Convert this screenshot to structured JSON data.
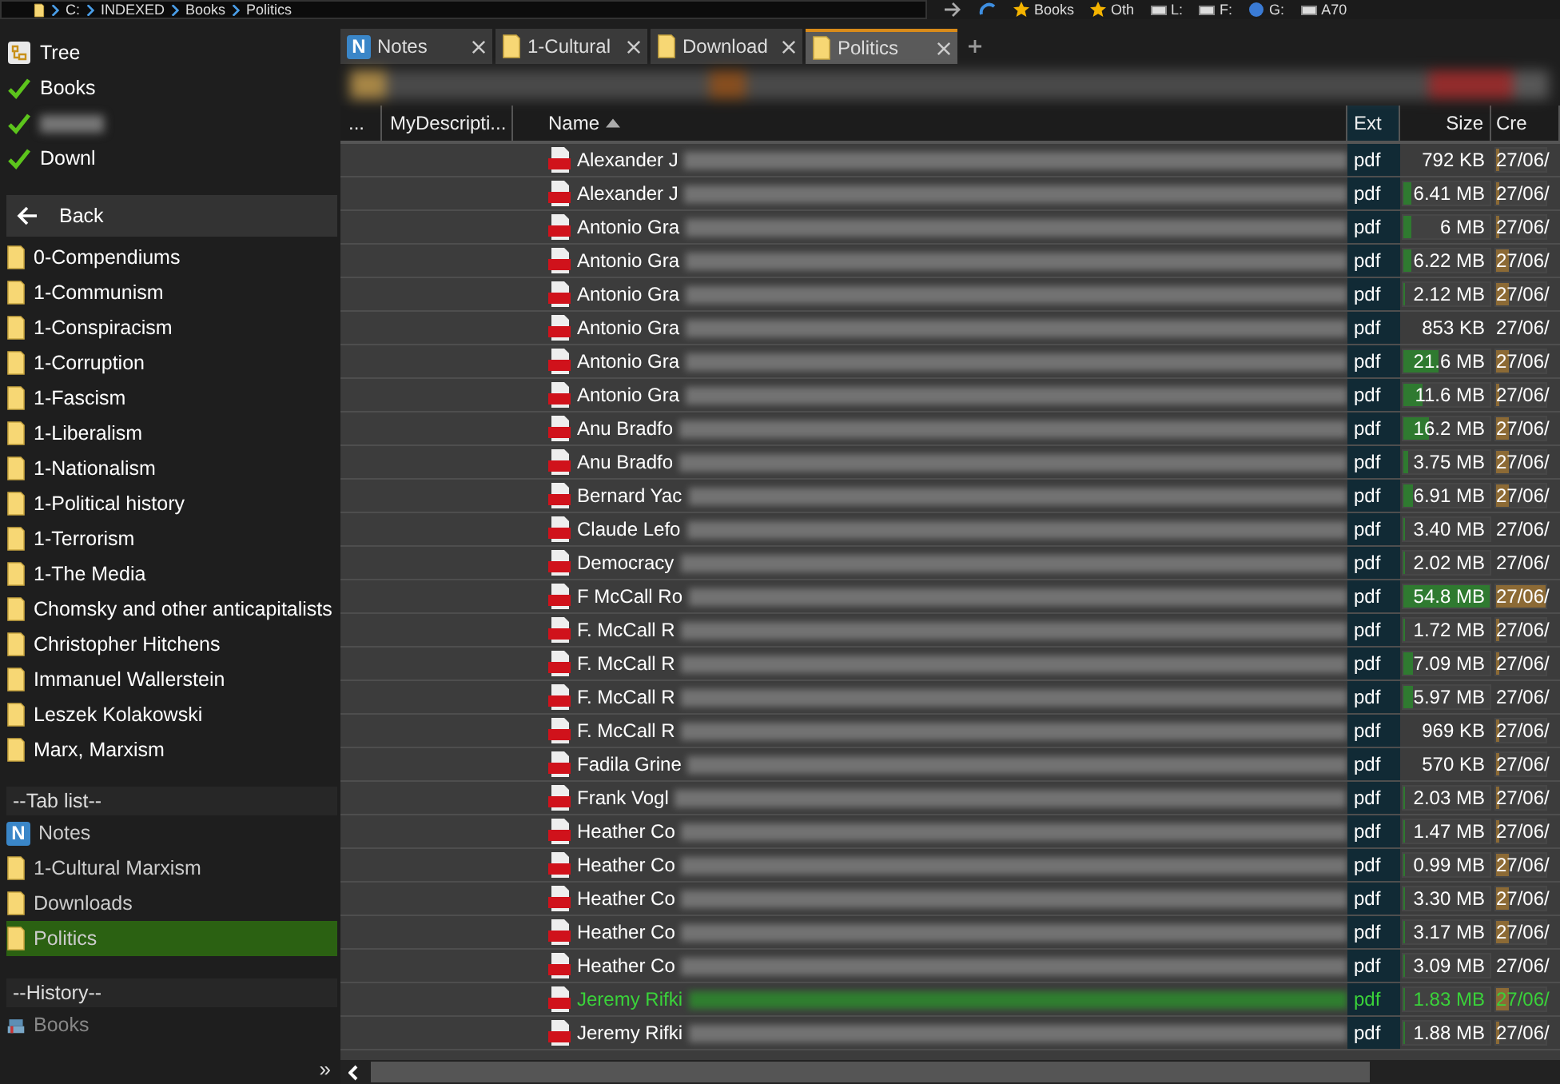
{
  "address_bar": {
    "segments": [
      "C:",
      "INDEXED",
      "Books",
      "Politics"
    ]
  },
  "top_toolbar": [
    {
      "kind": "star",
      "label": "Books"
    },
    {
      "kind": "star",
      "label": "Oth"
    },
    {
      "kind": "drive",
      "label": "L:"
    },
    {
      "kind": "drive",
      "label": "F:"
    },
    {
      "kind": "globe",
      "label": "G:"
    },
    {
      "kind": "drive",
      "label": "A70"
    }
  ],
  "sidebar": {
    "tree_label": "Tree",
    "favorites": [
      {
        "label": "Books",
        "blurred": false
      },
      {
        "blurred": true
      },
      {
        "label": "Downl",
        "blurred": false
      }
    ],
    "back_label": "Back",
    "folders": [
      "0-Compendiums",
      "1-Communism",
      "1-Conspiracism",
      "1-Corruption",
      "1-Fascism",
      "1-Liberalism",
      "1-Nationalism",
      "1-Political history",
      "1-Terrorism",
      "1-The Media",
      "Chomsky and other anticapitalists",
      "Christopher Hitchens",
      "Immanuel Wallerstein",
      "Leszek Kolakowski",
      "Marx, Marxism"
    ],
    "tab_list_heading": "--Tab list--",
    "tab_list": [
      {
        "kind": "notes",
        "icon_text": "N",
        "label": "Notes",
        "selected": false
      },
      {
        "kind": "folder",
        "label": "1-Cultural Marxism",
        "selected": false
      },
      {
        "kind": "folder",
        "label": "Downloads",
        "selected": false
      },
      {
        "kind": "folder",
        "label": "Politics",
        "selected": true
      }
    ],
    "history_heading": "--History--",
    "history": [
      {
        "label": "Books",
        "disabled": true
      }
    ],
    "expand_glyph": "»"
  },
  "tabs": [
    {
      "kind": "notes",
      "icon_text": "N",
      "label": "Notes",
      "selected": false
    },
    {
      "kind": "folder",
      "label": "1-Cultural",
      "selected": false
    },
    {
      "kind": "folder",
      "label": "Download",
      "selected": false
    },
    {
      "kind": "folder",
      "label": "Politics",
      "selected": true
    }
  ],
  "table": {
    "columns": [
      {
        "label": "..."
      },
      {
        "label": "MyDescripti..."
      },
      {
        "label": "Name",
        "sorted": true
      },
      {
        "label": "Ext"
      },
      {
        "label": "Size"
      },
      {
        "label": "Cre"
      }
    ],
    "rows": [
      {
        "name": "Alexander J",
        "ext": "pdf",
        "size": {
          "text": "792 KB"
        },
        "created": {
          "text": "27/06/",
          "level": 0.05
        },
        "highlighted": false
      },
      {
        "name": "Alexander J",
        "ext": "pdf",
        "size": {
          "text": "6.41 MB",
          "level": 0.1
        },
        "created": {
          "text": "27/06/",
          "level": 0.05
        },
        "highlighted": false
      },
      {
        "name": "Antonio Gra",
        "ext": "pdf",
        "size": {
          "text": "6 MB",
          "level": 0.1
        },
        "created": {
          "text": "27/06/",
          "level": 0.05
        },
        "highlighted": false
      },
      {
        "name": "Antonio Gra",
        "ext": "pdf",
        "size": {
          "text": "6.22 MB",
          "level": 0.1
        },
        "created": {
          "text": "27/06/",
          "level": 0.25
        },
        "highlighted": false
      },
      {
        "name": "Antonio Gra",
        "ext": "pdf",
        "size": {
          "text": "2.12 MB",
          "level": 0.02
        },
        "created": {
          "text": "27/06/",
          "level": 0.25
        },
        "highlighted": false
      },
      {
        "name": "Antonio Gra",
        "ext": "pdf",
        "size": {
          "text": "853 KB"
        },
        "created": {
          "text": "27/06/"
        },
        "highlighted": false
      },
      {
        "name": "Antonio Gra",
        "ext": "pdf",
        "size": {
          "text": "21.6 MB",
          "level": 0.4
        },
        "created": {
          "text": "27/06/",
          "level": 0.25
        },
        "highlighted": false
      },
      {
        "name": "Antonio Gra",
        "ext": "pdf",
        "size": {
          "text": "11.6 MB",
          "level": 0.22
        },
        "created": {
          "text": "27/06/",
          "level": 0.05
        },
        "highlighted": false
      },
      {
        "name": "Anu Bradfo",
        "ext": "pdf",
        "size": {
          "text": "16.2 MB",
          "level": 0.3
        },
        "created": {
          "text": "27/06/",
          "level": 0.25
        },
        "highlighted": false
      },
      {
        "name": "Anu Bradfo",
        "ext": "pdf",
        "size": {
          "text": "3.75 MB",
          "level": 0.06
        },
        "created": {
          "text": "27/06/",
          "level": 0.25
        },
        "highlighted": false
      },
      {
        "name": "Bernard Yac",
        "ext": "pdf",
        "size": {
          "text": "6.91 MB",
          "level": 0.12
        },
        "created": {
          "text": "27/06/",
          "level": 0.25
        },
        "highlighted": false
      },
      {
        "name": "Claude Lefo",
        "ext": "pdf",
        "size": {
          "text": "3.40 MB",
          "level": 0.02
        },
        "created": {
          "text": "27/06/"
        },
        "highlighted": false
      },
      {
        "name": "Democracy",
        "ext": "pdf",
        "size": {
          "text": "2.02 MB",
          "level": 0.02
        },
        "created": {
          "text": "27/06/"
        },
        "highlighted": false
      },
      {
        "name": "F McCall Ro",
        "ext": "pdf",
        "size": {
          "text": "54.8 MB",
          "level": 1
        },
        "created": {
          "text": "27/06/",
          "level": 1
        },
        "highlighted": false
      },
      {
        "name": "F. McCall R",
        "ext": "pdf",
        "size": {
          "text": "1.72 MB",
          "level": 0.02
        },
        "created": {
          "text": "27/06/",
          "level": 0.05
        },
        "highlighted": false
      },
      {
        "name": "F. McCall R",
        "ext": "pdf",
        "size": {
          "text": "7.09 MB",
          "level": 0.12
        },
        "created": {
          "text": "27/06/",
          "level": 0.05
        },
        "highlighted": false
      },
      {
        "name": "F. McCall R",
        "ext": "pdf",
        "size": {
          "text": "5.97 MB",
          "level": 0.12
        },
        "created": {
          "text": "27/06/"
        },
        "highlighted": false
      },
      {
        "name": "F. McCall R",
        "ext": "pdf",
        "size": {
          "text": "969 KB"
        },
        "created": {
          "text": "27/06/",
          "level": 0.05
        },
        "highlighted": false
      },
      {
        "name": "Fadila Grine",
        "ext": "pdf",
        "size": {
          "text": "570 KB"
        },
        "created": {
          "text": "27/06/",
          "level": 0.05
        },
        "highlighted": false
      },
      {
        "name": "Frank Vogl",
        "ext": "pdf",
        "size": {
          "text": "2.03 MB",
          "level": 0.02
        },
        "created": {
          "text": "27/06/",
          "level": 0.05
        },
        "highlighted": false
      },
      {
        "name": "Heather Co",
        "ext": "pdf",
        "size": {
          "text": "1.47 MB",
          "level": 0.02
        },
        "created": {
          "text": "27/06/",
          "level": 0.05
        },
        "highlighted": false
      },
      {
        "name": "Heather Co",
        "ext": "pdf",
        "size": {
          "text": "0.99 MB",
          "level": 0.02
        },
        "created": {
          "text": "27/06/",
          "level": 0.25
        },
        "highlighted": false
      },
      {
        "name": "Heather Co",
        "ext": "pdf",
        "size": {
          "text": "3.30 MB",
          "level": 0.02
        },
        "created": {
          "text": "27/06/",
          "level": 0.25
        },
        "highlighted": false
      },
      {
        "name": "Heather Co",
        "ext": "pdf",
        "size": {
          "text": "3.17 MB",
          "level": 0.02
        },
        "created": {
          "text": "27/06/",
          "level": 0.25
        },
        "highlighted": false
      },
      {
        "name": "Heather Co",
        "ext": "pdf",
        "size": {
          "text": "3.09 MB",
          "level": 0.02
        },
        "created": {
          "text": "27/06/"
        },
        "highlighted": false
      },
      {
        "name": "Jeremy Rifki",
        "ext": "pdf",
        "size": {
          "text": "1.83 MB",
          "level": 0.02
        },
        "created": {
          "text": "27/06/",
          "level": 0.25
        },
        "highlighted": true
      },
      {
        "name": "Jeremy Rifki",
        "ext": "pdf",
        "size": {
          "text": "1.88 MB",
          "level": 0.02
        },
        "created": {
          "text": "27/06/",
          "level": 0.05
        },
        "highlighted": false
      }
    ]
  }
}
